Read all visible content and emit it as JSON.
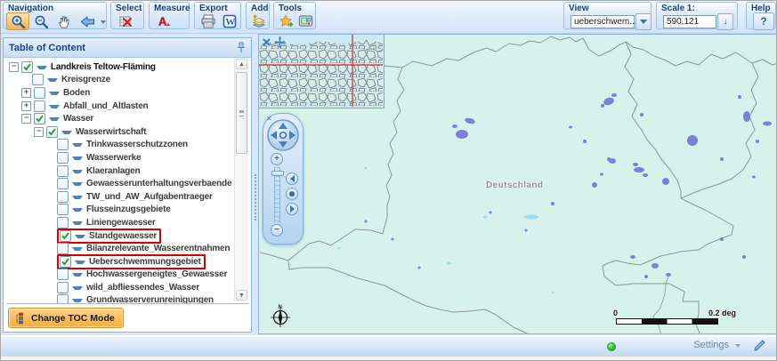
{
  "colors": {
    "accent-orange": "#fbae4c",
    "group-title-blue": "#15428b",
    "map-background": "#d7f2eb",
    "flood-area-purple": "#7d80d9",
    "lake-cyan": "#97dff0",
    "highlight-red": "#d20000",
    "status-green": "#2eb733"
  },
  "toolbar": {
    "groups": {
      "navigation": {
        "label": "Navigation",
        "buttons": [
          {
            "name": "zoom-in",
            "active": true
          },
          {
            "name": "zoom-out",
            "active": false
          },
          {
            "name": "pan",
            "active": false
          },
          {
            "name": "back-extent",
            "active": false,
            "has_dropdown": true
          }
        ]
      },
      "select": {
        "label": "Select",
        "buttons": [
          {
            "name": "select-features"
          }
        ]
      },
      "measure": {
        "label": "Measure",
        "buttons": [
          {
            "name": "measure-label"
          }
        ]
      },
      "export": {
        "label": "Export",
        "buttons": [
          {
            "name": "print"
          },
          {
            "name": "export-word"
          }
        ]
      },
      "add": {
        "label": "Add",
        "buttons": [
          {
            "name": "add-layer"
          }
        ]
      },
      "tools": {
        "label": "Tools",
        "buttons": [
          {
            "name": "tools-extra"
          },
          {
            "name": "tools-viewer"
          }
        ]
      },
      "view": {
        "label": "View",
        "value": "ueberschwem..."
      },
      "scale": {
        "label": "Scale 1:",
        "value": "590,121"
      },
      "help": {
        "label": "Help",
        "button_label": "?"
      }
    }
  },
  "toc": {
    "title": "Table of Content",
    "change_mode_label": "Change TOC Mode",
    "items": [
      {
        "label": "Landkreis Teltow-Fläming",
        "level": 0,
        "expander": "minus",
        "checked": true,
        "highlighted": false
      },
      {
        "label": "Kreisgrenze",
        "level": 1,
        "expander": null,
        "checked": false,
        "highlighted": false
      },
      {
        "label": "Boden",
        "level": 1,
        "expander": "plus",
        "checked": false,
        "highlighted": false
      },
      {
        "label": "Abfall_und_Altlasten",
        "level": 1,
        "expander": "plus",
        "checked": false,
        "highlighted": false
      },
      {
        "label": "Wasser",
        "level": 1,
        "expander": "minus",
        "checked": true,
        "highlighted": false
      },
      {
        "label": "Wasserwirtschaft",
        "level": 2,
        "expander": "minus",
        "checked": true,
        "highlighted": false
      },
      {
        "label": "Trinkwasserschutzzonen",
        "level": 3,
        "expander": null,
        "checked": false,
        "highlighted": false
      },
      {
        "label": "Wasserwerke",
        "level": 3,
        "expander": null,
        "checked": false,
        "highlighted": false
      },
      {
        "label": "Klaeranlagen",
        "level": 3,
        "expander": null,
        "checked": false,
        "highlighted": false
      },
      {
        "label": "Gewaesserunterhaltungsverbaende",
        "level": 3,
        "expander": null,
        "checked": false,
        "highlighted": false
      },
      {
        "label": "TW_und_AW_Aufgabentraeger",
        "level": 3,
        "expander": null,
        "checked": false,
        "highlighted": false
      },
      {
        "label": "Flusseinzugsgebiete",
        "level": 3,
        "expander": null,
        "checked": false,
        "highlighted": false
      },
      {
        "label": "Liniengewaesser",
        "level": 3,
        "expander": null,
        "checked": false,
        "highlighted": false
      },
      {
        "label": "Standgewaesser",
        "level": 3,
        "expander": null,
        "checked": true,
        "highlighted": true
      },
      {
        "label": "Bilanzrelevante_Wasserentnahmen",
        "level": 3,
        "expander": null,
        "checked": false,
        "highlighted": false
      },
      {
        "label": "Ueberschwemmungsgebiet",
        "level": 3,
        "expander": null,
        "checked": true,
        "highlighted": true
      },
      {
        "label": "Hochwassergeneigtes_Gewaesser",
        "level": 3,
        "expander": null,
        "checked": false,
        "highlighted": false
      },
      {
        "label": "wild_abfliessendes_Wasser",
        "level": 3,
        "expander": null,
        "checked": false,
        "highlighted": false
      },
      {
        "label": "Grundwasserverunreinigungen",
        "level": 3,
        "expander": null,
        "checked": false,
        "highlighted": false
      }
    ]
  },
  "map": {
    "country_label": "Deutschland",
    "overview_icons": [
      "close",
      "move"
    ],
    "scalebar": {
      "start": "0",
      "end": "0.2 deg"
    }
  },
  "statusbar": {
    "settings_label": "Settings"
  }
}
